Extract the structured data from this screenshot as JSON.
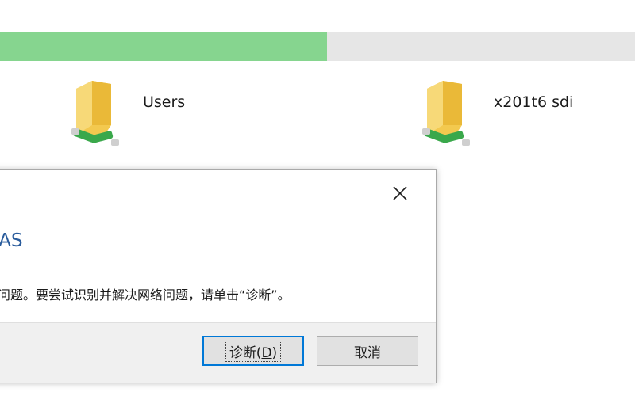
{
  "progress": {
    "fraction": 0.515,
    "fill_color": "#86d58f",
    "track_color": "#e6e6e6"
  },
  "shares": [
    {
      "label": "Users",
      "icon": "network-folder-icon"
    },
    {
      "label": "x201t6 sdi",
      "icon": "network-folder-icon"
    }
  ],
  "dialog": {
    "title_visible": "NAS",
    "message_visible": "有问题。要尝试识别并解决网络问题，请单击“诊断”。",
    "diagnose_button": {
      "label_main": "诊断(",
      "label_key": "D",
      "label_end": ")"
    },
    "cancel_button": {
      "label": "取消"
    },
    "accent_color": "#0078d7",
    "title_color": "#2a5c9c"
  }
}
